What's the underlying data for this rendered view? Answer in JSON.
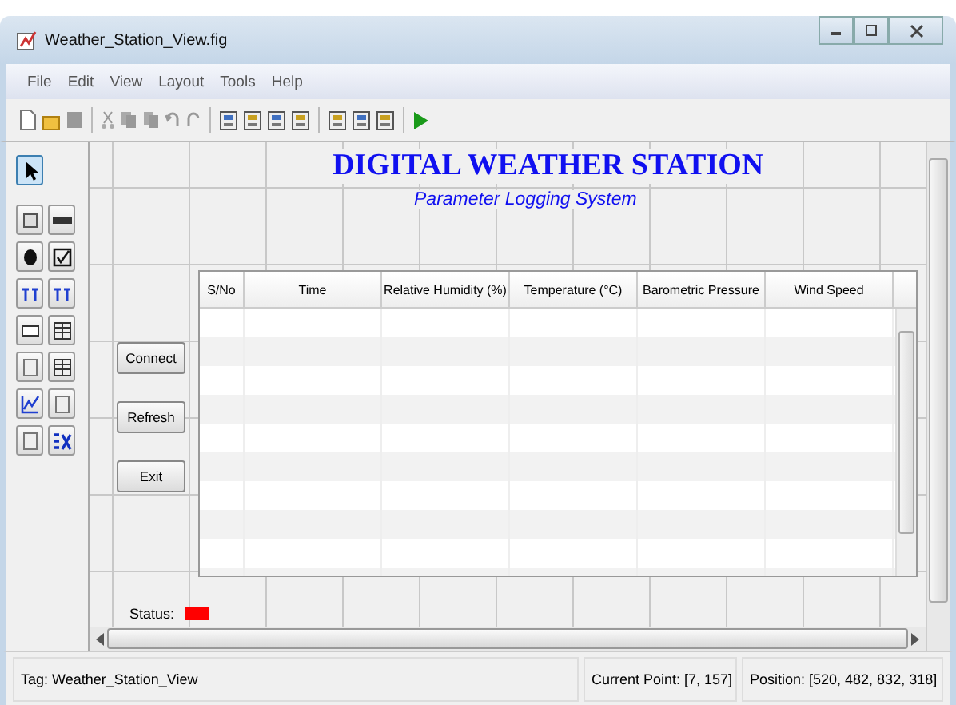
{
  "window": {
    "title": "Weather_Station_View.fig"
  },
  "menu": [
    "File",
    "Edit",
    "View",
    "Layout",
    "Tools",
    "Help"
  ],
  "canvas": {
    "heading": "DIGITAL WEATHER STATION",
    "subheading": "Parameter Logging System",
    "buttons": [
      "Connect",
      "Refresh",
      "Exit"
    ],
    "table": {
      "columns": [
        "S/No",
        "Time",
        "Relative Humidity (%)",
        "Temperature (°C)",
        "Barometric Pressure",
        "Wind Speed"
      ]
    },
    "status": {
      "label": "Status:",
      "color": "#ff0000"
    }
  },
  "status_bar": {
    "tag": "Tag: Weather_Station_View",
    "current_point": "Current Point:  [7, 157]",
    "position": "Position: [520, 482, 832, 318]"
  }
}
